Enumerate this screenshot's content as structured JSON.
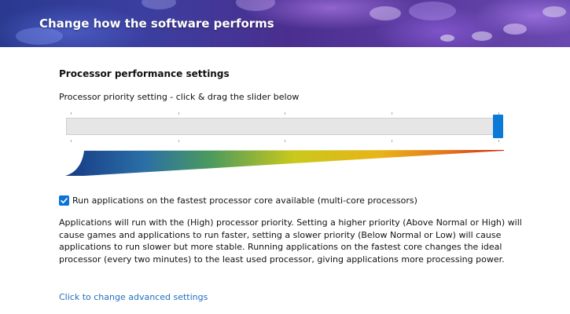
{
  "header": {
    "title": "Change how the software performs"
  },
  "processor": {
    "section_title": "Processor performance settings",
    "slider_caption": "Processor priority setting - click & drag the slider below",
    "priority_level_fraction": 1.0,
    "ramp_colors": [
      "#1a3f8a",
      "#2a7ab0",
      "#d8d020",
      "#e8a020",
      "#d83010"
    ]
  },
  "options": {
    "fastest_core_label": "Run applications on the fastest processor core available (multi-core processors)",
    "fastest_core_checked": true,
    "accent_color": "#0a74d4"
  },
  "description": {
    "text": "Applications will run with the (High) processor priority.  Setting a higher priority (Above Normal or High) will cause games and applications to run faster, setting a slower priority (Below Normal or Low) will cause applications to run slower but more stable.  Running applications on the fastest core changes the ideal processor (every two minutes) to the least used processor, giving applications more processing power."
  },
  "links": {
    "advanced_settings": "Click to change advanced settings"
  }
}
